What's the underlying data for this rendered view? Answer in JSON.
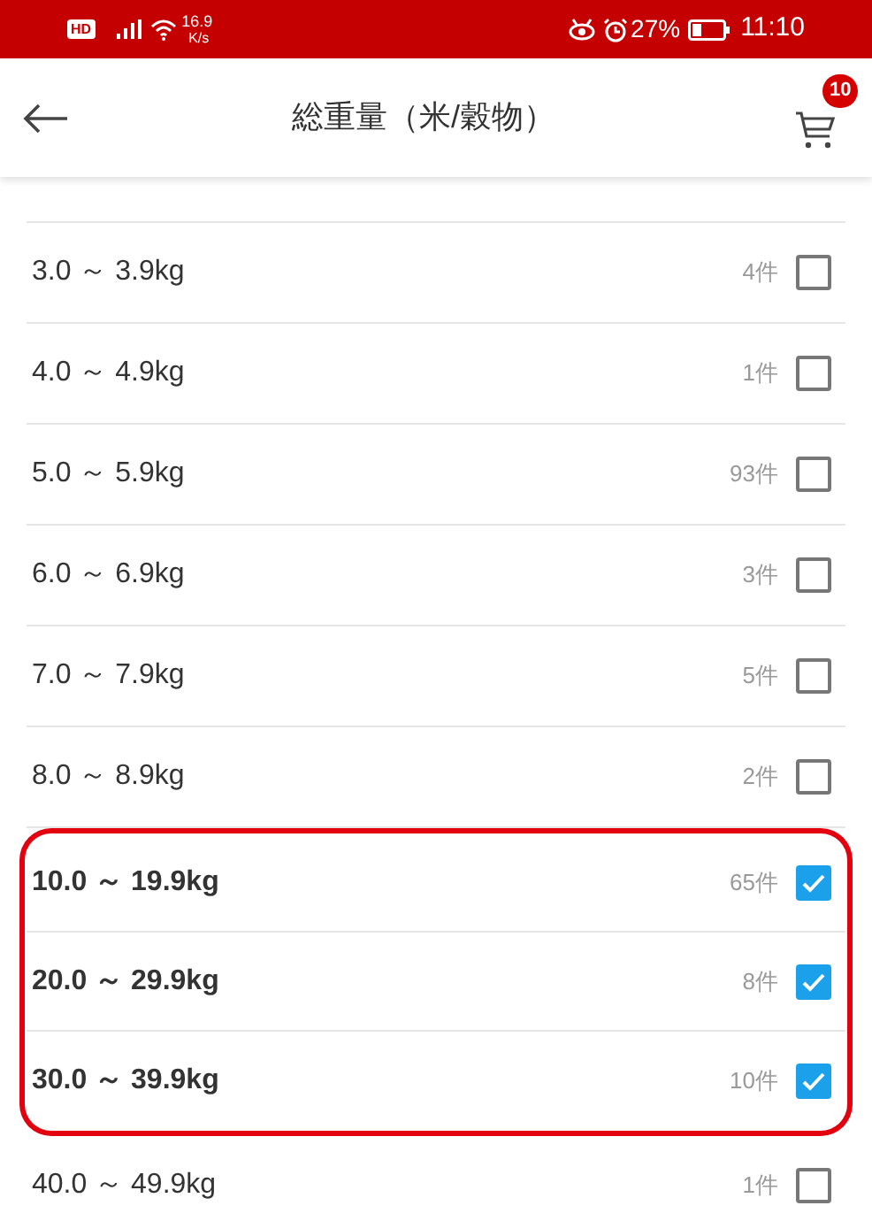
{
  "status_bar": {
    "hd": "HD",
    "speed": "16.9",
    "speed_unit": "K/s",
    "battery": "27%",
    "time": "11:10"
  },
  "header": {
    "title": "総重量（米/穀物）",
    "cart_badge": "10"
  },
  "options": [
    {
      "label": "3.0 ～ 3.9kg",
      "count": "4件",
      "selected": false,
      "highlighted": false
    },
    {
      "label": "4.0 ～ 4.9kg",
      "count": "1件",
      "selected": false,
      "highlighted": false
    },
    {
      "label": "5.0 ～ 5.9kg",
      "count": "93件",
      "selected": false,
      "highlighted": false
    },
    {
      "label": "6.0 ～ 6.9kg",
      "count": "3件",
      "selected": false,
      "highlighted": false
    },
    {
      "label": "7.0 ～ 7.9kg",
      "count": "5件",
      "selected": false,
      "highlighted": false
    },
    {
      "label": "8.0 ～ 8.9kg",
      "count": "2件",
      "selected": false,
      "highlighted": false
    },
    {
      "label": "10.0 ～ 19.9kg",
      "count": "65件",
      "selected": true,
      "highlighted": true
    },
    {
      "label": "20.0 ～ 29.9kg",
      "count": "8件",
      "selected": true,
      "highlighted": true
    },
    {
      "label": "30.0 ～ 39.9kg",
      "count": "10件",
      "selected": true,
      "highlighted": true
    },
    {
      "label": "40.0 ～ 49.9kg",
      "count": "1件",
      "selected": false,
      "highlighted": false
    }
  ]
}
